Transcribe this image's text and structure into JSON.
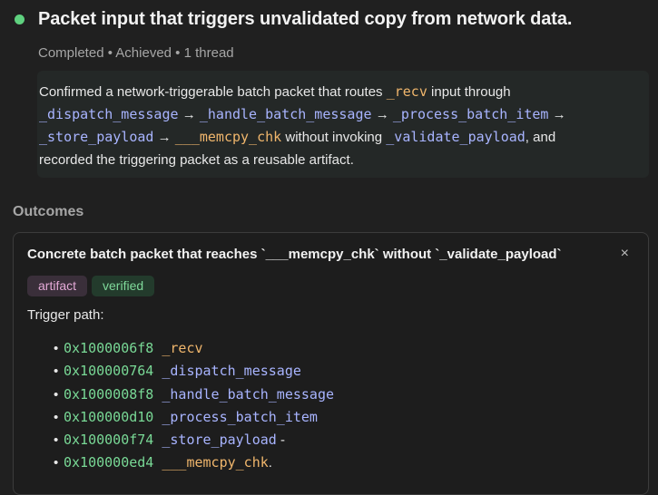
{
  "header": {
    "title": "Packet input that triggers unvalidated copy from network data.",
    "meta": "Completed • Achieved • 1 thread",
    "status_color": "#5fd17f"
  },
  "summary": {
    "line1_text": "Confirmed a network-triggerable batch packet that routes ",
    "line1_recv": "_recv",
    "line1_tail": " input through",
    "line2_fn1": "_dispatch_message",
    "line2_fn2": "_handle_batch_message",
    "line2_fn3": "_process_batch_item",
    "line3_fn1": "_store_payload",
    "line3_fn2": "___memcpy_chk",
    "line3_mid": " without invoking ",
    "line3_fn3": "_validate_payload",
    "line3_tail": ", and",
    "line4": "recorded the triggering packet as a reusable artifact.",
    "arrow": "→"
  },
  "outcomes": {
    "heading": "Outcomes",
    "card": {
      "title": "Concrete batch packet that reaches `___memcpy_chk` without `_validate_payload`",
      "close_label": "×",
      "tags": [
        "artifact",
        "verified"
      ],
      "trigger_label": "Trigger path:",
      "path": [
        {
          "addr": "0x1000006f8",
          "sym": "_recv",
          "suffix": ""
        },
        {
          "addr": "0x100000764",
          "sym": "_dispatch_message",
          "suffix": ""
        },
        {
          "addr": "0x1000008f8",
          "sym": "_handle_batch_message",
          "suffix": ""
        },
        {
          "addr": "0x100000d10",
          "sym": "_process_batch_item",
          "suffix": ""
        },
        {
          "addr": "0x100000f74",
          "sym": "_store_payload",
          "suffix": " -"
        },
        {
          "addr": "0x100000ed4",
          "sym": "___memcpy_chk",
          "suffix": "."
        }
      ],
      "bullet": "•"
    }
  }
}
